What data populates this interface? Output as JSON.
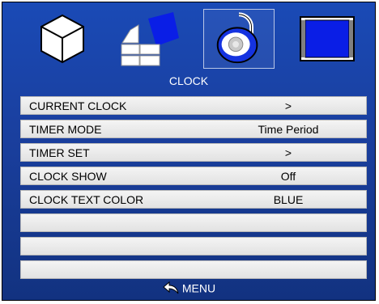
{
  "menu": {
    "title": "CLOCK",
    "icons": [
      {
        "name": "cube-icon",
        "selected": false
      },
      {
        "name": "shapes-icon",
        "selected": false
      },
      {
        "name": "lock-icon",
        "selected": true
      },
      {
        "name": "monitor-icon",
        "selected": false
      }
    ],
    "rows": [
      {
        "label": "CURRENT CLOCK",
        "value": ">"
      },
      {
        "label": "TIMER MODE",
        "value": "Time Period"
      },
      {
        "label": "TIMER SET",
        "value": ">"
      },
      {
        "label": "CLOCK SHOW",
        "value": "Off"
      },
      {
        "label": "CLOCK TEXT COLOR",
        "value": "BLUE"
      },
      {
        "label": "",
        "value": ""
      },
      {
        "label": "",
        "value": ""
      },
      {
        "label": "",
        "value": ""
      }
    ],
    "footer": {
      "label": "MENU",
      "icon": "back-arrow-icon"
    }
  },
  "colors": {
    "background": "#1a4ab6",
    "row": "#eeeeee",
    "text": "#000000",
    "accent_blue": "#1533e0"
  }
}
